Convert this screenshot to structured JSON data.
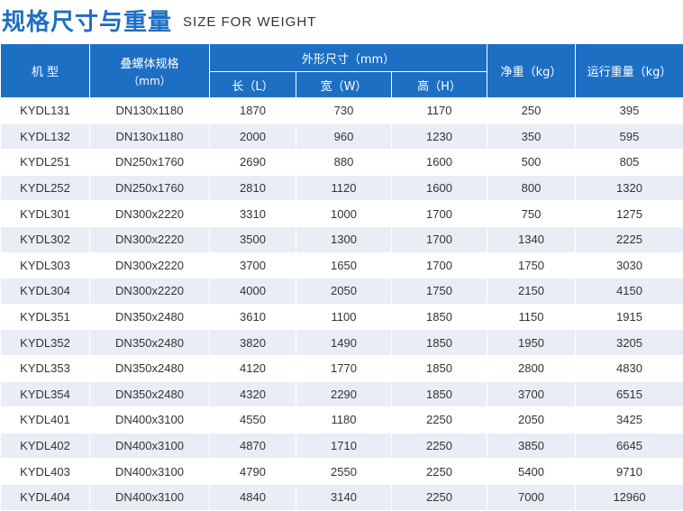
{
  "title": {
    "cn": "规格尺寸与重量",
    "en": "SIZE FOR WEIGHT"
  },
  "header": {
    "model": "机 型",
    "screw_spec": "叠螺体规格",
    "screw_unit": "（mm）",
    "dimensions": "外形尺寸（mm）",
    "length": "长（L）",
    "width": "宽（W）",
    "height": "高（H）",
    "net_weight": "净重（kg）",
    "run_weight": "运行重量（kg）"
  },
  "rows": [
    [
      "KYDL131",
      "DN130x1180",
      "1870",
      "730",
      "1170",
      "250",
      "395"
    ],
    [
      "KYDL132",
      "DN130x1180",
      "2000",
      "960",
      "1230",
      "350",
      "595"
    ],
    [
      "KYDL251",
      "DN250x1760",
      "2690",
      "880",
      "1600",
      "500",
      "805"
    ],
    [
      "KYDL252",
      "DN250x1760",
      "2810",
      "1120",
      "1600",
      "800",
      "1320"
    ],
    [
      "KYDL301",
      "DN300x2220",
      "3310",
      "1000",
      "1700",
      "750",
      "1275"
    ],
    [
      "KYDL302",
      "DN300x2220",
      "3500",
      "1300",
      "1700",
      "1340",
      "2225"
    ],
    [
      "KYDL303",
      "DN300x2220",
      "3700",
      "1650",
      "1700",
      "1750",
      "3030"
    ],
    [
      "KYDL304",
      "DN300x2220",
      "4000",
      "2050",
      "1750",
      "2150",
      "4150"
    ],
    [
      "KYDL351",
      "DN350x2480",
      "3610",
      "1100",
      "1850",
      "1150",
      "1915"
    ],
    [
      "KYDL352",
      "DN350x2480",
      "3820",
      "1490",
      "1850",
      "1950",
      "3205"
    ],
    [
      "KYDL353",
      "DN350x2480",
      "4120",
      "1770",
      "1850",
      "2800",
      "4830"
    ],
    [
      "KYDL354",
      "DN350x2480",
      "4320",
      "2290",
      "1850",
      "3700",
      "6515"
    ],
    [
      "KYDL401",
      "DN400x3100",
      "4550",
      "1180",
      "2250",
      "2050",
      "3425"
    ],
    [
      "KYDL402",
      "DN400x3100",
      "4870",
      "1710",
      "2250",
      "3850",
      "6645"
    ],
    [
      "KYDL403",
      "DN400x3100",
      "4790",
      "2550",
      "2250",
      "5400",
      "9710"
    ],
    [
      "KYDL404",
      "DN400x3100",
      "4840",
      "3140",
      "2250",
      "7000",
      "12960"
    ]
  ],
  "colors": {
    "header_bg": "#1d6fc4",
    "stripe": "#e9edf5",
    "title": "#1d6fc4"
  }
}
